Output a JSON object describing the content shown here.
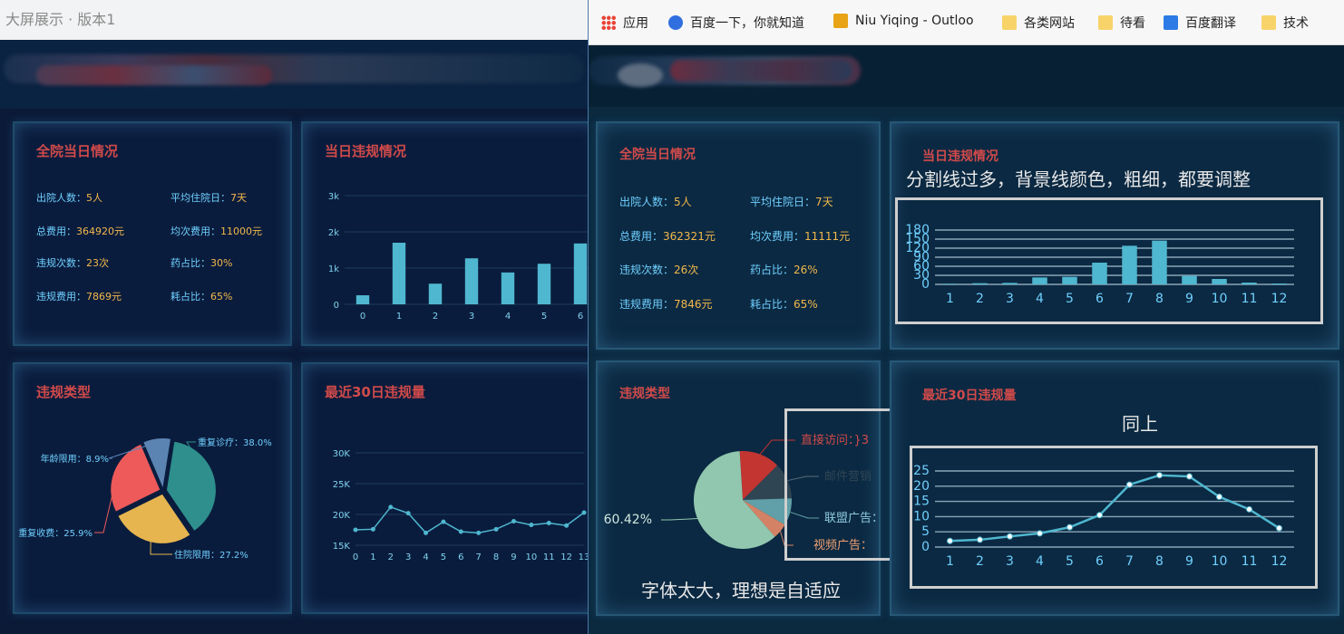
{
  "left_window": {
    "title": "大屏展示 · 版本1",
    "overview": {
      "title": "全院当日情况",
      "items": [
        {
          "label": "出院人数：",
          "value": "5人"
        },
        {
          "label": "平均住院日：",
          "value": "7天"
        },
        {
          "label": "总费用：",
          "value": "364920元"
        },
        {
          "label": "均次费用：",
          "value": "11000元"
        },
        {
          "label": "违规次数：",
          "value": "23次"
        },
        {
          "label": "药占比：",
          "value": "30%"
        },
        {
          "label": "违规费用：",
          "value": "7869元"
        },
        {
          "label": "耗占比：",
          "value": "65%"
        }
      ]
    },
    "violation_today": {
      "title": "当日违规情况"
    },
    "violation_type": {
      "title": "违规类型"
    },
    "recent30": {
      "title": "最近30日违规量"
    }
  },
  "right_window": {
    "bookmarks": [
      {
        "label": "应用",
        "icon": "apps-grid-icon"
      },
      {
        "label": "百度一下，你就知道",
        "icon": "baidu-paw-icon"
      },
      {
        "label": "Niu Yiqing - Outloo",
        "icon": "outlook-icon"
      },
      {
        "label": "各类网站",
        "icon": "folder-icon"
      },
      {
        "label": "待看",
        "icon": "folder-icon"
      },
      {
        "label": "百度翻译",
        "icon": "translate-icon"
      },
      {
        "label": "技术",
        "icon": "folder-icon"
      }
    ],
    "overview": {
      "title": "全院当日情况",
      "items": [
        {
          "label": "出院人数：",
          "value": "5人"
        },
        {
          "label": "平均住院日：",
          "value": "7天"
        },
        {
          "label": "总费用：",
          "value": "362321元"
        },
        {
          "label": "均次费用：",
          "value": "11111元"
        },
        {
          "label": "违规次数：",
          "value": "26次"
        },
        {
          "label": "药占比：",
          "value": "26%"
        },
        {
          "label": "违规费用：",
          "value": "7846元"
        },
        {
          "label": "耗占比：",
          "value": "65%"
        }
      ]
    },
    "violation_today": {
      "title": "当日违规情况"
    },
    "violation_type": {
      "title": "违规类型",
      "labels": [
        "直接访问：}3",
        "邮件营销",
        "联盟广告：",
        "视频广告："
      ],
      "big_label": "60.42%"
    },
    "recent30": {
      "title": "最近30日违规量"
    },
    "annotations": {
      "bar_note": "分割线过多，背景线颜色，粗细，都要调整",
      "line_note": "同上",
      "pie_note": "字体太大，理想是自适应"
    }
  },
  "colors": {
    "accent_red": "#d04a4a",
    "label_cyan": "#6fd0ff",
    "value_yellow": "#f2b84b",
    "bar_cyan": "#4fb7cf"
  },
  "chart_data": [
    {
      "type": "bar",
      "title": "当日违规情况",
      "categories": [
        "0",
        "1",
        "2",
        "3",
        "4",
        "5",
        "6"
      ],
      "values": [
        250,
        1700,
        570,
        1270,
        880,
        1120,
        1680
      ],
      "ylim": [
        0,
        3000
      ],
      "yticks": [
        "0",
        "1k",
        "2k",
        "3k"
      ]
    },
    {
      "type": "pie",
      "title": "违规类型",
      "slices": [
        {
          "name": "重复诊疗",
          "value": 38.0,
          "label": "重复诊疗：38.0%",
          "color": "#2e8f8c"
        },
        {
          "name": "住院限用",
          "value": 27.2,
          "label": "住院限用：27.2%",
          "color": "#e6b54f"
        },
        {
          "name": "重复收费",
          "value": 25.9,
          "label": "重复收费：25.9%",
          "color": "#ee5a5a"
        },
        {
          "name": "年龄限用",
          "value": 8.9,
          "label": "年龄限用：8.9%",
          "color": "#5c84b3"
        }
      ]
    },
    {
      "type": "line",
      "title": "最近30日违规量",
      "x": [
        "0",
        "1",
        "2",
        "3",
        "4",
        "5",
        "6",
        "7",
        "8",
        "9",
        "10",
        "11",
        "12",
        "13"
      ],
      "values": [
        17500,
        17600,
        21200,
        20200,
        17000,
        18800,
        17200,
        17000,
        17600,
        18900,
        18300,
        18600,
        18200,
        20300
      ],
      "ylim": [
        15000,
        30000
      ],
      "yticks": [
        "15K",
        "20K",
        "25K",
        "30K"
      ]
    },
    {
      "type": "bar",
      "title": "当日违规情况",
      "categories": [
        "1",
        "2",
        "3",
        "4",
        "5",
        "6",
        "7",
        "8",
        "9",
        "10",
        "11",
        "12"
      ],
      "values": [
        2,
        4,
        5,
        23,
        25,
        72,
        128,
        145,
        28,
        18,
        6,
        3
      ],
      "ylim": [
        0,
        180
      ],
      "yticks": [
        "0",
        "30",
        "60",
        "90",
        "120",
        "150",
        "180"
      ]
    },
    {
      "type": "pie",
      "title": "违规类型",
      "slices": [
        {
          "name": "直接访问",
          "value": 13.5,
          "color": "#c23531"
        },
        {
          "name": "邮件营销",
          "value": 12.0,
          "color": "#2f4554"
        },
        {
          "name": "联盟广告",
          "value": 9.0,
          "color": "#61a0a8"
        },
        {
          "name": "视频广告",
          "value": 5.08,
          "color": "#d48265"
        },
        {
          "name": "",
          "value": 60.42,
          "color": "#91c7ae"
        }
      ]
    },
    {
      "type": "line",
      "title": "最近30日违规量",
      "x": [
        "1",
        "2",
        "3",
        "4",
        "5",
        "6",
        "7",
        "8",
        "9",
        "10",
        "11",
        "12"
      ],
      "values": [
        2,
        2.4,
        3.5,
        4.5,
        6.5,
        10.5,
        20.5,
        23.6,
        23.2,
        16.5,
        12.4,
        6.2
      ],
      "ylim": [
        0,
        25
      ],
      "yticks": [
        "0",
        "5",
        "10",
        "15",
        "20",
        "25"
      ]
    }
  ]
}
